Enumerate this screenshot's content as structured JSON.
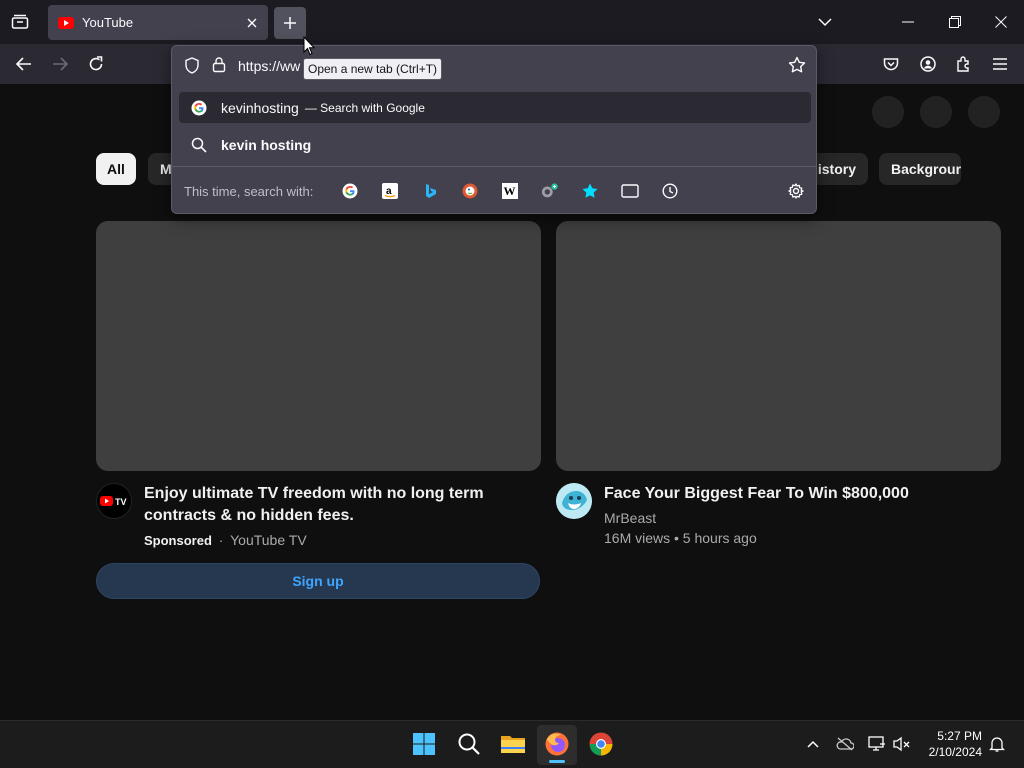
{
  "browser": {
    "tab_title": "YouTube",
    "url_text": "https://ww",
    "tooltip": "Open a new tab (Ctrl+T)"
  },
  "urlbar": {
    "suggestion_primary": "kevinhosting",
    "suggestion_primary_sub": "— Search with Google",
    "suggestion_secondary": "kevin hosting",
    "search_with_label": "This time, search with:",
    "engines": [
      "google-icon",
      "amazon-icon",
      "bing-icon",
      "duckduckgo-icon",
      "wikipedia-icon",
      "search-addon-icon",
      "bookmarks-icon",
      "tabs-icon",
      "history-icon"
    ]
  },
  "chips": [
    {
      "label": "All",
      "active": true
    },
    {
      "label": "M"
    },
    {
      "label": "History"
    },
    {
      "label": "Backgrour"
    }
  ],
  "videos": [
    {
      "title_line1": "Enjoy ultimate TV freedom with no long term",
      "title_line2": "contracts & no hidden fees.",
      "sponsored": "Sponsored",
      "channel": "YouTube TV",
      "cta": "Sign up"
    },
    {
      "title": "Face Your Biggest Fear To Win $800,000",
      "channel": "MrBeast",
      "meta": "16M views • 5 hours ago"
    }
  ],
  "taskbar": {
    "time": "5:27 PM",
    "date": "2/10/2024"
  },
  "colors": {
    "accent": "#4cc2ff",
    "link": "#3ea6ff",
    "youtube_red": "#ff0000"
  }
}
